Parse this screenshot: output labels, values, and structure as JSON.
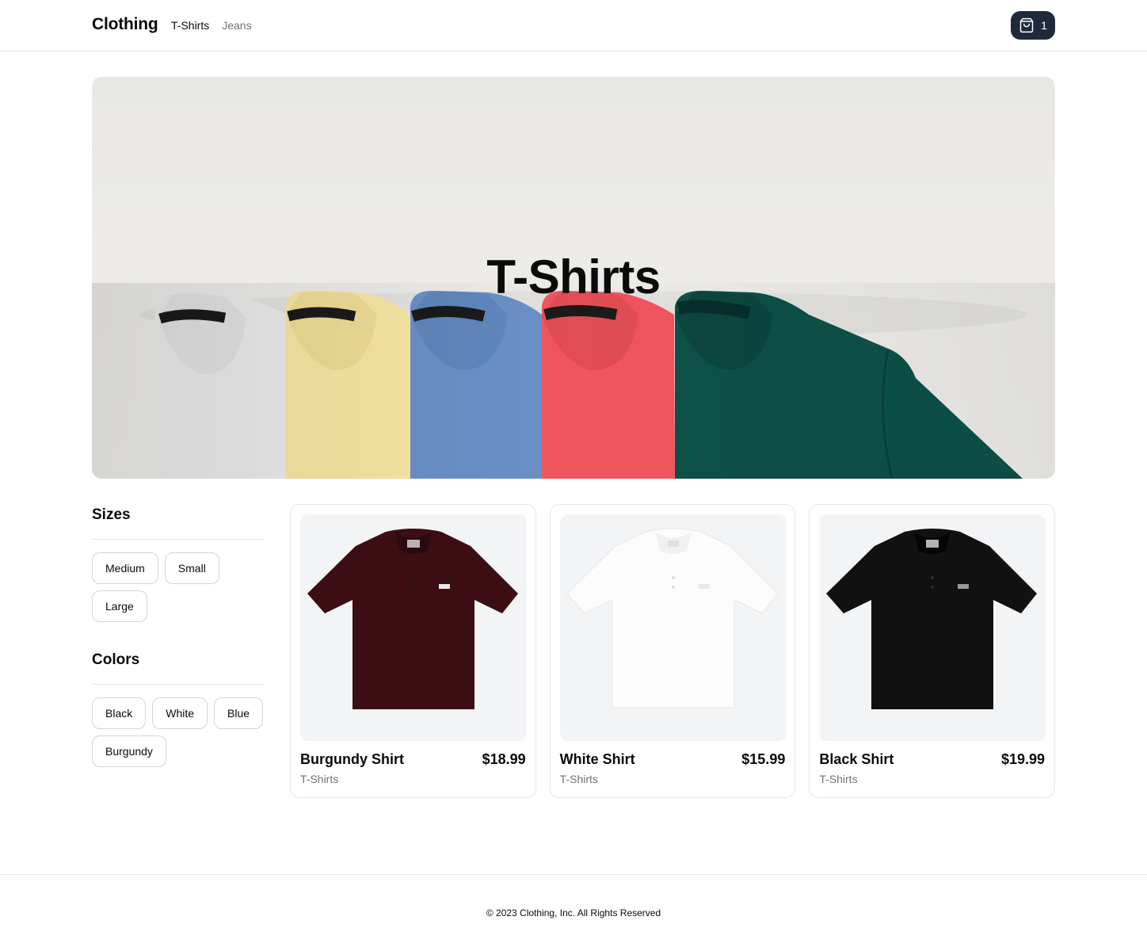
{
  "header": {
    "logo": "Clothing",
    "nav": [
      {
        "label": "T-Shirts",
        "active": true
      },
      {
        "label": "Jeans",
        "active": false
      }
    ],
    "cart_count": "1"
  },
  "hero": {
    "title": "T-Shirts"
  },
  "filters": {
    "sizes": {
      "title": "Sizes",
      "options": [
        "Medium",
        "Small",
        "Large"
      ]
    },
    "colors": {
      "title": "Colors",
      "options": [
        "Black",
        "White",
        "Blue",
        "Burgundy"
      ]
    }
  },
  "products": [
    {
      "name": "Burgundy Shirt",
      "price": "$18.99",
      "category": "T-Shirts",
      "color": "#3d0d14"
    },
    {
      "name": "White Shirt",
      "price": "$15.99",
      "category": "T-Shirts",
      "color": "#fafafa"
    },
    {
      "name": "Black Shirt",
      "price": "$19.99",
      "category": "T-Shirts",
      "color": "#111111"
    }
  ],
  "footer": {
    "copyright": "© 2023 Clothing, Inc. All Rights Reserved"
  }
}
